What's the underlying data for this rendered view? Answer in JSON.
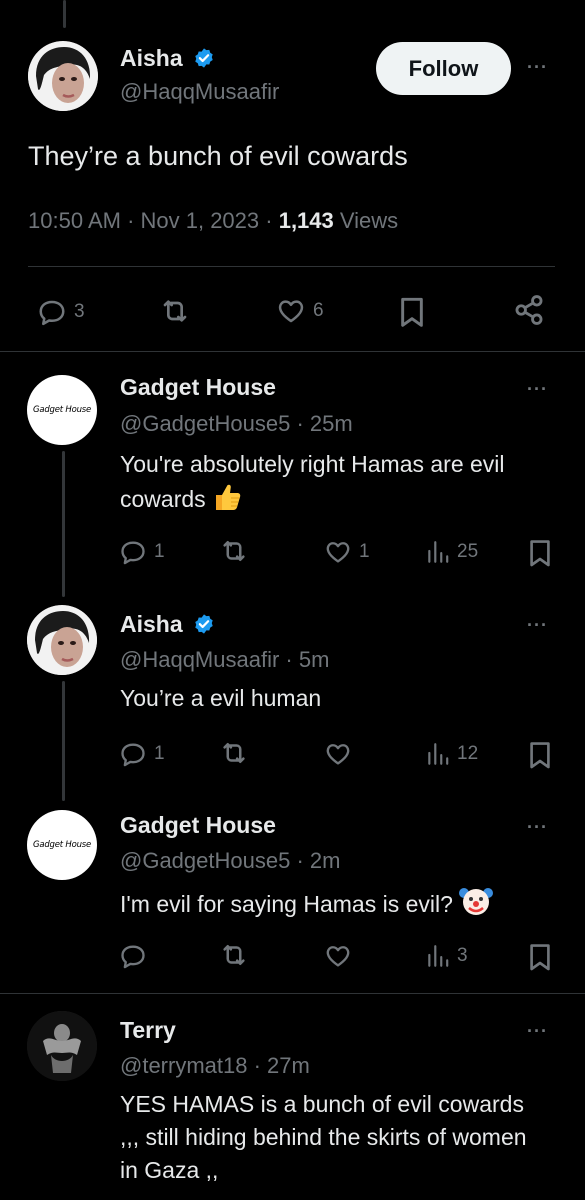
{
  "main_tweet": {
    "name": "Aisha",
    "handle": "@HaqqMusaafir",
    "follow_label": "Follow",
    "text": "They’re a bunch of evil cowards",
    "time": "10:50 AM · Nov 1, 2023 · ",
    "views_count": "1,143",
    "views_label": " Views",
    "replies": "3",
    "likes": "6"
  },
  "replies": [
    {
      "name": "Gadget House",
      "avatar_text": "Gadget House",
      "handle_time": "@GadgetHouse5 · 25m",
      "text": "You're absolutely right Hamas are evil cowards",
      "emoji": "thumbs-up",
      "replies": "1",
      "likes": "1",
      "views": "25"
    },
    {
      "name": "Aisha",
      "handle_time": "@HaqqMusaafir · 5m",
      "text": "You’re a evil human",
      "replies": "1",
      "likes": "",
      "views": "12"
    },
    {
      "name": "Gadget House",
      "avatar_text": "Gadget House",
      "handle_time": "@GadgetHouse5 · 2m",
      "text": "I'm evil for saying Hamas is evil?",
      "emoji": "clown-face",
      "replies": "",
      "likes": "",
      "views": "3"
    },
    {
      "name": "Terry",
      "handle_time": "@terrymat18 · 27m",
      "text": "YES HAMAS is a bunch of evil cowards ,,, still hiding behind the skirts of women in Gaza ,,"
    }
  ],
  "colors": {
    "background": "#000000",
    "text": "#e7e9ea",
    "muted": "#71767b",
    "verified": "#1d9bf0",
    "divider": "#2f3336"
  }
}
